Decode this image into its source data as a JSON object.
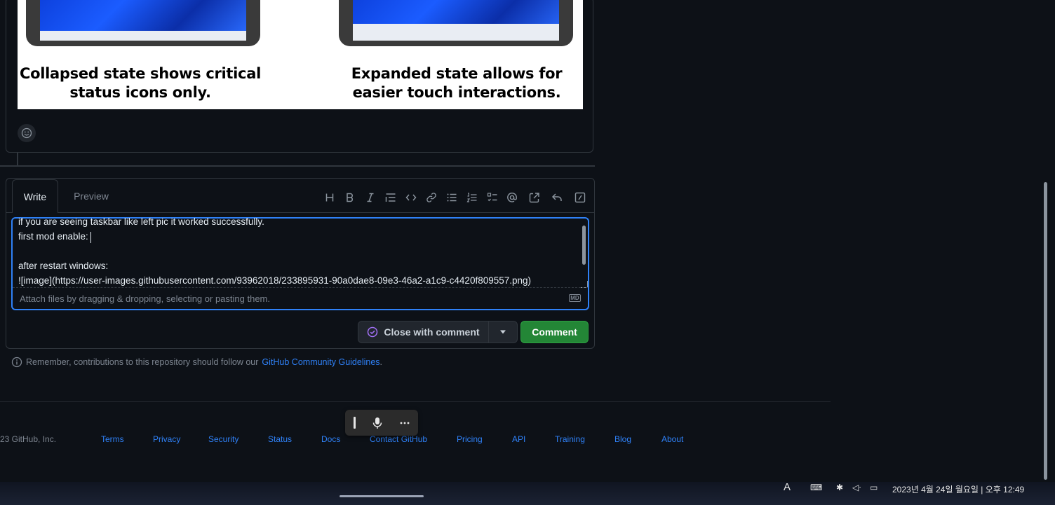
{
  "embed_image": {
    "caption_left": "Collapsed state shows critical status icons only.",
    "caption_left_line1": "Collapsed state shows critical",
    "caption_left_line2": "status icons only.",
    "caption_right_line1": "Expanded state allows for",
    "caption_right_line2": "easier touch interactions."
  },
  "editor": {
    "tab_write": "Write",
    "tab_preview": "Preview",
    "toolbar": [
      "heading-icon",
      "bold-icon",
      "italic-icon",
      "quote-icon",
      "code-icon",
      "link-icon",
      "bulleted-list-icon",
      "numbered-list-icon",
      "task-list-icon",
      "mention-icon",
      "reference-icon",
      "reply-icon",
      "slash-commands-icon"
    ],
    "lines": [
      "if you are seeing taskbar like left pic it worked successfully.",
      "first mod enable:",
      "",
      "after restart windows:",
      "![image](https://user-images.githubusercontent.com/93962018/233895931-90a0dae8-09e3-46a2-a1c9-c4420f809557.png)"
    ],
    "attach_placeholder": "Attach files by dragging & dropping, selecting or pasting them.",
    "markdown_badge": "MD"
  },
  "actions": {
    "close_label": "Close with comment",
    "comment_label": "Comment"
  },
  "notice": {
    "text": "Remember, contributions to this repository should follow our",
    "link": "GitHub Community Guidelines",
    "suffix": "."
  },
  "footer": {
    "copyright": "23 GitHub, Inc.",
    "links": [
      "Terms",
      "Privacy",
      "Security",
      "Status",
      "Docs",
      "Contact GitHub",
      "Pricing",
      "API",
      "Training",
      "Blog",
      "About"
    ]
  },
  "taskbar": {
    "ime": "A",
    "datetime": "2023년 4월 24일 월요일 | 오후 12:49"
  },
  "colors": {
    "background": "#0d1117",
    "border": "#30363d",
    "link": "#2f81f7",
    "comment_button": "#238636",
    "close_icon": "#a371f7"
  }
}
